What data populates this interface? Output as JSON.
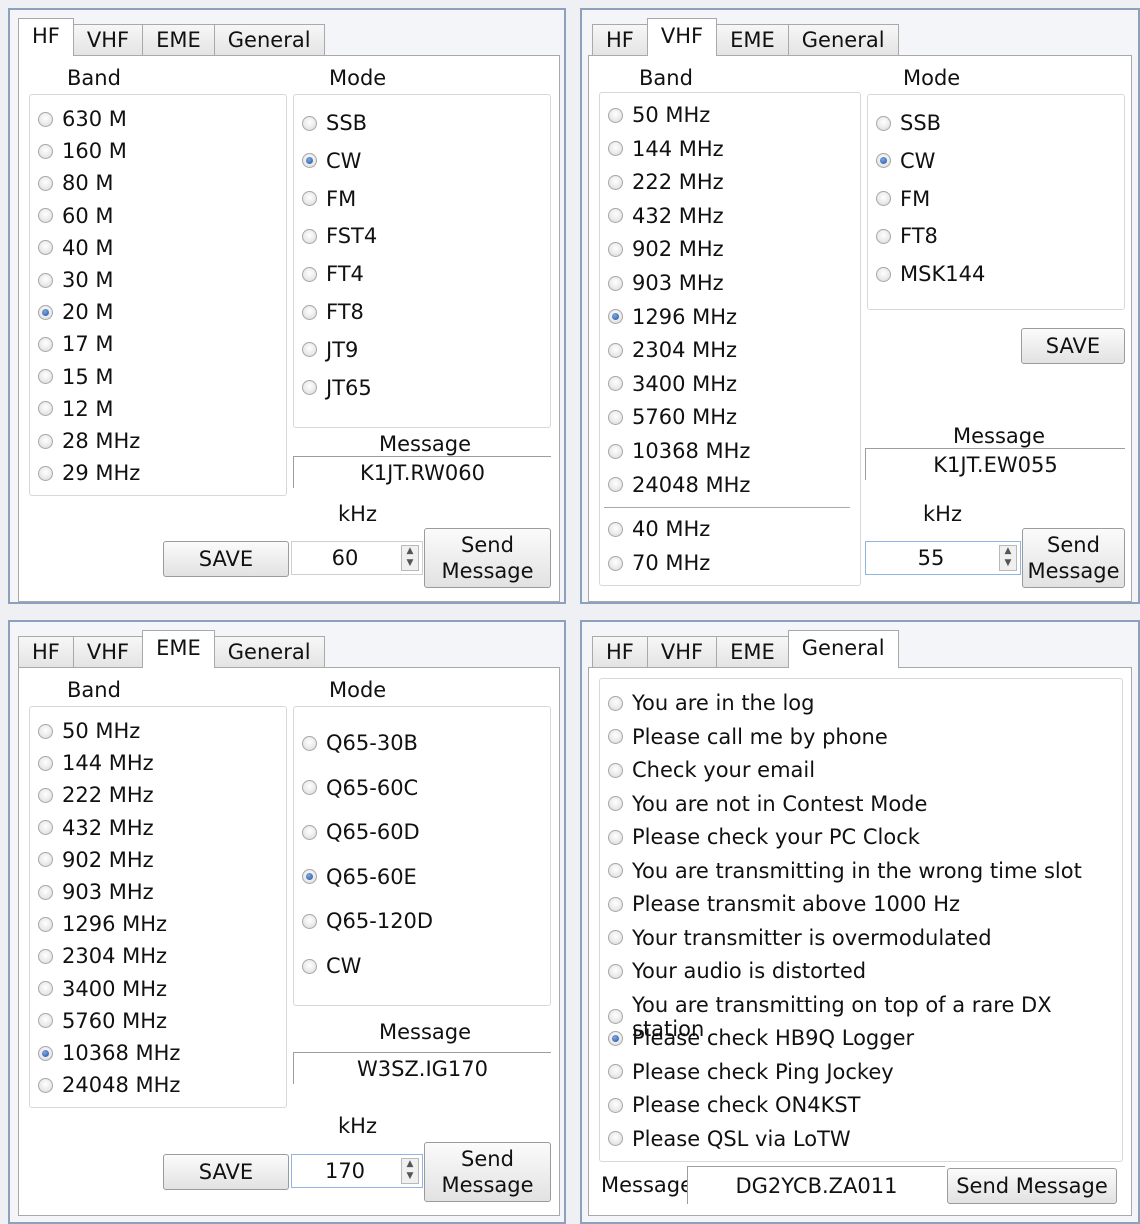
{
  "tabs": [
    "HF",
    "VHF",
    "EME",
    "General"
  ],
  "common": {
    "band_label": "Band",
    "mode_label": "Mode",
    "message_label": "Message",
    "khz_label": "kHz",
    "save_label": "SAVE",
    "send_line1": "Send",
    "send_line2": "Message"
  },
  "hf": {
    "active_tab": "HF",
    "bands": [
      "630 M",
      "160 M",
      "80 M",
      "60 M",
      "40 M",
      "30 M",
      "20 M",
      "17 M",
      "15 M",
      "12 M",
      "28 MHz",
      "29 MHz"
    ],
    "band_selected": "20 M",
    "modes": [
      "SSB",
      "CW",
      "FM",
      "FST4",
      "FT4",
      "FT8",
      "JT9",
      "JT65"
    ],
    "mode_selected": "CW",
    "message": "K1JT.RW060",
    "khz": "60"
  },
  "vhf": {
    "active_tab": "VHF",
    "bands": [
      "50 MHz",
      "144 MHz",
      "222 MHz",
      "432 MHz",
      "902 MHz",
      "903 MHz",
      "1296 MHz",
      "2304 MHz",
      "3400 MHz",
      "5760 MHz",
      "10368 MHz",
      "24048 MHz"
    ],
    "extra_bands": [
      "40 MHz",
      "70 MHz"
    ],
    "band_selected": "1296 MHz",
    "modes": [
      "SSB",
      "CW",
      "FM",
      "FT8",
      "MSK144"
    ],
    "mode_selected": "CW",
    "message": "K1JT.EW055",
    "khz": "55"
  },
  "eme": {
    "active_tab": "EME",
    "bands": [
      "50 MHz",
      "144 MHz",
      "222 MHz",
      "432 MHz",
      "902 MHz",
      "903 MHz",
      "1296 MHz",
      "2304 MHz",
      "3400 MHz",
      "5760 MHz",
      "10368 MHz",
      "24048 MHz"
    ],
    "band_selected": "10368 MHz",
    "modes": [
      "Q65-30B",
      "Q65-60C",
      "Q65-60D",
      "Q65-60E",
      "Q65-120D",
      "CW"
    ],
    "mode_selected": "Q65-60E",
    "message": "W3SZ.IG170",
    "khz": "170"
  },
  "general": {
    "active_tab": "General",
    "options": [
      "You are in the log",
      "Please call me by phone",
      "Check your email",
      "You are not in Contest Mode",
      "Please check your PC Clock",
      "You are transmitting in the wrong time slot",
      "Please transmit above 1000 Hz",
      "Your transmitter is overmodulated",
      "Your audio is distorted",
      "You are transmitting on top of a rare DX station",
      "Please check HB9Q Logger",
      "Please check Ping Jockey",
      "Please check ON4KST",
      "Please QSL via LoTW"
    ],
    "option_selected": "Please check HB9Q Logger",
    "message_label": "Message",
    "message": "DG2YCB.ZA011",
    "send_label": "Send Message"
  }
}
